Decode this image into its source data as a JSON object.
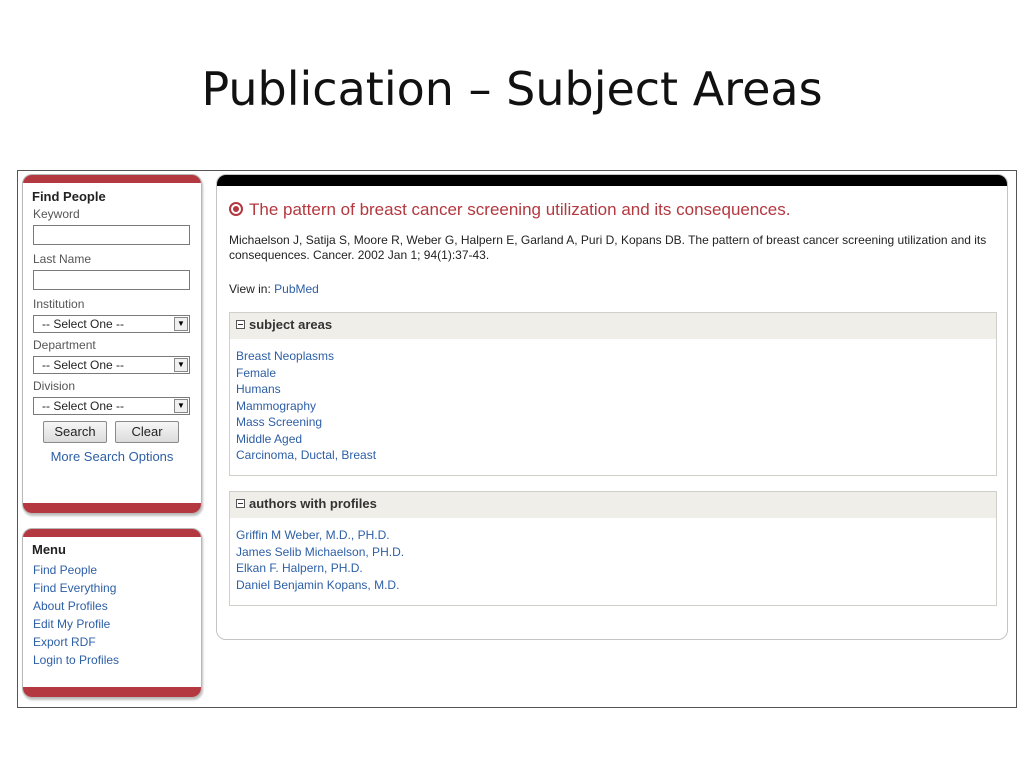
{
  "slide": {
    "title": "Publication – Subject Areas"
  },
  "find_people": {
    "heading": "Find People",
    "keyword_label": "Keyword",
    "keyword_value": "",
    "last_name_label": "Last Name",
    "last_name_value": "",
    "institution_label": "Institution",
    "institution_value": "-- Select One --",
    "department_label": "Department",
    "department_value": "-- Select One --",
    "division_label": "Division",
    "division_value": "-- Select One --",
    "search_label": "Search",
    "clear_label": "Clear",
    "more_options_label": "More Search Options"
  },
  "menu": {
    "heading": "Menu",
    "items": [
      {
        "label": "Find People"
      },
      {
        "label": "Find Everything"
      },
      {
        "label": "About Profiles"
      },
      {
        "label": "Edit My Profile"
      },
      {
        "label": "Export RDF"
      },
      {
        "label": "Login to Profiles"
      }
    ]
  },
  "publication": {
    "title": "The pattern of breast cancer screening utilization and its consequences.",
    "citation": "Michaelson J, Satija S, Moore R, Weber G, Halpern E, Garland A, Puri D, Kopans DB. The pattern of breast cancer screening utilization and its consequences. Cancer. 2002 Jan 1; 94(1):37-43.",
    "view_in_label": "View in: ",
    "view_in_link": "PubMed"
  },
  "subject_areas": {
    "heading": "subject areas",
    "items": [
      "Breast Neoplasms",
      "Female",
      "Humans",
      "Mammography",
      "Mass Screening",
      "Middle Aged",
      "Carcinoma, Ductal, Breast"
    ]
  },
  "authors": {
    "heading": "authors with profiles",
    "items": [
      "Griffin M Weber, M.D., PH.D.",
      "James Selib Michaelson, PH.D.",
      "Elkan F. Halpern, PH.D.",
      "Daniel Benjamin Kopans, M.D."
    ]
  },
  "colors": {
    "accent_red": "#b3383f",
    "link_blue": "#2d5fa6",
    "section_header_bg": "#efeee8"
  },
  "icons": {
    "select_arrow": "chevron-down-icon",
    "title_bullet": "radio-icon",
    "section_toggle": "collapse-icon"
  }
}
